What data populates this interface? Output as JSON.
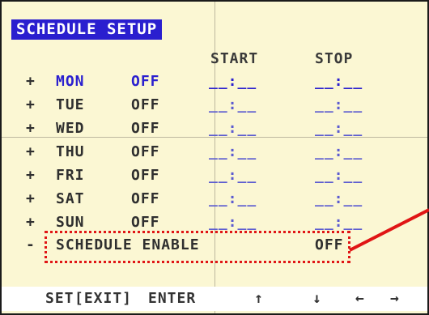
{
  "screen": {
    "title": "SCHEDULE SETUP",
    "columns": {
      "start": "START",
      "stop": "STOP"
    },
    "rows": [
      {
        "marker": "+",
        "day": "MON",
        "state": "OFF",
        "start": "__:__",
        "stop": "__:__",
        "active": true
      },
      {
        "marker": "+",
        "day": "TUE",
        "state": "OFF",
        "start": "__:__",
        "stop": "__:__",
        "active": false
      },
      {
        "marker": "+",
        "day": "WED",
        "state": "OFF",
        "start": "__:__",
        "stop": "__:__",
        "active": false
      },
      {
        "marker": "+",
        "day": "THU",
        "state": "OFF",
        "start": "__:__",
        "stop": "__:__",
        "active": false
      },
      {
        "marker": "+",
        "day": "FRI",
        "state": "OFF",
        "start": "__:__",
        "stop": "__:__",
        "active": false
      },
      {
        "marker": "+",
        "day": "SAT",
        "state": "OFF",
        "start": "__:__",
        "stop": "__:__",
        "active": false
      },
      {
        "marker": "+",
        "day": "SUN",
        "state": "OFF",
        "start": "__:__",
        "stop": "__:__",
        "active": false
      }
    ],
    "schedule_enable": {
      "marker": "-",
      "label": "SCHEDULE ENABLE",
      "value": "OFF"
    },
    "footer": {
      "set": "SET",
      "exit": "[EXIT]",
      "enter": "ENTER",
      "arrows": [
        "↑",
        "↓",
        "←",
        "→"
      ]
    }
  },
  "colors": {
    "background": "#fbf7d3",
    "title_bg": "#2a1fcf",
    "title_fg": "#ffffff",
    "active": "#2a1fcf",
    "text": "#2f2f2f",
    "highlight": "#e01515"
  }
}
